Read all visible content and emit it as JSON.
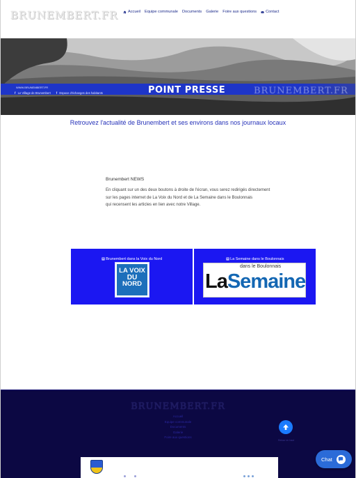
{
  "header": {
    "logo": "BRUNEMBERT.FR",
    "nav": [
      {
        "label": "Accueil",
        "icon": "home-icon"
      },
      {
        "label": "Equipe communale",
        "icon": ""
      },
      {
        "label": "Documents",
        "icon": ""
      },
      {
        "label": "Galerie",
        "icon": ""
      },
      {
        "label": "Foire aux questions",
        "icon": ""
      },
      {
        "label": "Contact",
        "icon": "envelope-icon"
      }
    ]
  },
  "banner": {
    "site": "WWW.BRUNEMBERT.FR",
    "links": [
      {
        "label": "Le Village de Brunembert",
        "icon": "facebook-icon"
      },
      {
        "label": "Espace d'échanges des habitants",
        "icon": "facebook-icon"
      }
    ],
    "title": "POINT PRESSE",
    "logo": "BRUNEMBERT.FR",
    "strip_color": "#1e35c8"
  },
  "main": {
    "subtitle": "Retrouvez l'actualité de Brunembert et ses environs dans nos journaux locaux",
    "news_title": "Brunembert NEWS",
    "news_lines": [
      "En cliquant sur un des deux boutons à droite de l'écran, vous serez redirigés directement",
      "sur les pages internet de La Voix du Nord et de La Semaine dans le Boulonnais",
      "qui recensent les articles en lien avec notre Village."
    ],
    "cards": [
      {
        "title": "Brunembert dans la Voix du Nord",
        "logo_lines": [
          "LA VOIX",
          "DU",
          "NORD"
        ]
      },
      {
        "title": "La Semaine dans le Boulonnais",
        "logo_small": "dans le Boulonnais",
        "logo_la": "La",
        "logo_sem": "Semaine"
      }
    ],
    "card_color": "#1b17f2"
  },
  "footer": {
    "logo": "BRUNEMBERT.FR",
    "links": [
      "Accueil",
      "Equipe communale",
      "Documents",
      "Galerie",
      "Foire aux questions"
    ],
    "up_label": "Retour en haut",
    "background": "#0c0843"
  },
  "chat": {
    "label": "Chat",
    "icon": "chat-bubble-icon"
  }
}
